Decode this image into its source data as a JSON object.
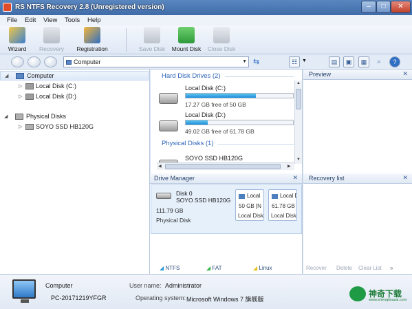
{
  "window": {
    "title": "RS NTFS Recovery 2.8 (Unregistered version)",
    "controls": {
      "minimize": "–",
      "maximize": "□",
      "close": "✕"
    }
  },
  "menu": [
    "File",
    "Edit",
    "View",
    "Tools",
    "Help"
  ],
  "toolbar": {
    "wizard": "Wizard",
    "recovery": "Recovery",
    "registration": "Registration",
    "save_disk": "Save Disk",
    "mount_disk": "Mount Disk",
    "close_disk": "Close Disk"
  },
  "address": {
    "value": "Computer"
  },
  "tree": {
    "computer": "Computer",
    "local_c": "Local Disk (C:)",
    "local_d": "Local Disk (D:)",
    "physical_disks": "Physical Disks",
    "soyo": "SOYO SSD HB120G"
  },
  "drives": {
    "hdd_group": "Hard Disk Drives (2)",
    "c_name": "Local Disk (C:)",
    "c_free": "17.27 GB free of 50 GB",
    "c_used_fraction": 0.655,
    "d_name": "Local Disk (D:)",
    "d_free": "49.02 GB free of 61.78 GB",
    "d_used_fraction": 0.206,
    "phys_group": "Physical Disks (1)",
    "soyo_name": "SOYO SSD HB120G"
  },
  "preview": {
    "title": "Preview"
  },
  "drive_manager": {
    "title": "Drive Manager",
    "disk_label": "Disk 0",
    "disk_model": "SOYO SSD HB120G",
    "disk_size": "111.79 GB",
    "disk_type": "Physical Disk",
    "p1_name": "Local",
    "p1_size": "50 GB [N",
    "p1_fs": "Local Disk",
    "p2_name": "Local D",
    "p2_size": "61.78 GB",
    "p2_fs": "Local Disk",
    "legend": [
      "NTFS",
      "FAT",
      "Linux"
    ]
  },
  "recovery_list": {
    "title": "Recovery list",
    "actions": [
      "Recover",
      "Delete",
      "Clear List"
    ]
  },
  "status": {
    "name": "Computer",
    "pc": "PC-20171219YFGR",
    "user_label": "User name:",
    "user": "Administrator",
    "os_label": "Operating system:",
    "os": "Microsoft Windows 7 旗舰版"
  },
  "watermark": {
    "text": "神奇下载",
    "sub": "www.shenqixiazai.com"
  },
  "colors": {
    "accent": "#2a62b8",
    "bar": "#1d8fd8",
    "title_bg": "#3f6ba8"
  }
}
